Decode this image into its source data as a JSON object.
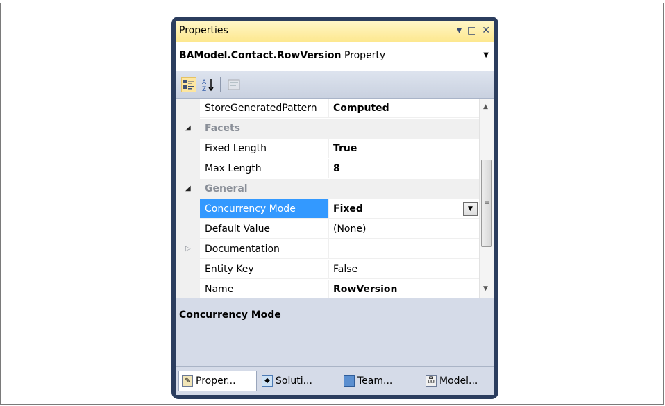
{
  "window": {
    "title": "Properties",
    "controls": [
      "▾",
      "□",
      "✕"
    ]
  },
  "selector": {
    "object_name": "BAModel.Contact.RowVersion",
    "object_type": "Property"
  },
  "toolbar": {
    "categorized_icon": "categorized-icon",
    "alphabetical_icon": "alphabetical-icon",
    "property_pages_icon": "property-pages-icon"
  },
  "grid": {
    "rows": [
      {
        "kind": "prop",
        "name": "StoreGeneratedPattern",
        "value": "Computed",
        "bold": true
      },
      {
        "kind": "cat",
        "name": "Facets",
        "expanded": true
      },
      {
        "kind": "prop",
        "name": "Fixed Length",
        "value": "True",
        "bold": true
      },
      {
        "kind": "prop",
        "name": "Max Length",
        "value": "8",
        "bold": true
      },
      {
        "kind": "cat",
        "name": "General",
        "expanded": true
      },
      {
        "kind": "prop",
        "name": "Concurrency Mode",
        "value": "Fixed",
        "bold": true,
        "selected": true
      },
      {
        "kind": "prop",
        "name": "Default Value",
        "value": "(None)",
        "bold": false
      },
      {
        "kind": "prop",
        "name": "Documentation",
        "value": "",
        "bold": false,
        "collapsed": true
      },
      {
        "kind": "prop",
        "name": "Entity Key",
        "value": "False",
        "bold": false
      },
      {
        "kind": "prop",
        "name": "Name",
        "value": "RowVersion",
        "bold": true
      }
    ]
  },
  "description": {
    "title": "Concurrency Mode"
  },
  "tabs": [
    {
      "label": "Proper...",
      "active": true,
      "icon": "properties-icon"
    },
    {
      "label": "Soluti...",
      "active": false,
      "icon": "solution-explorer-icon"
    },
    {
      "label": "Team...",
      "active": false,
      "icon": "team-explorer-icon"
    },
    {
      "label": "Model...",
      "active": false,
      "icon": "model-browser-icon"
    }
  ]
}
